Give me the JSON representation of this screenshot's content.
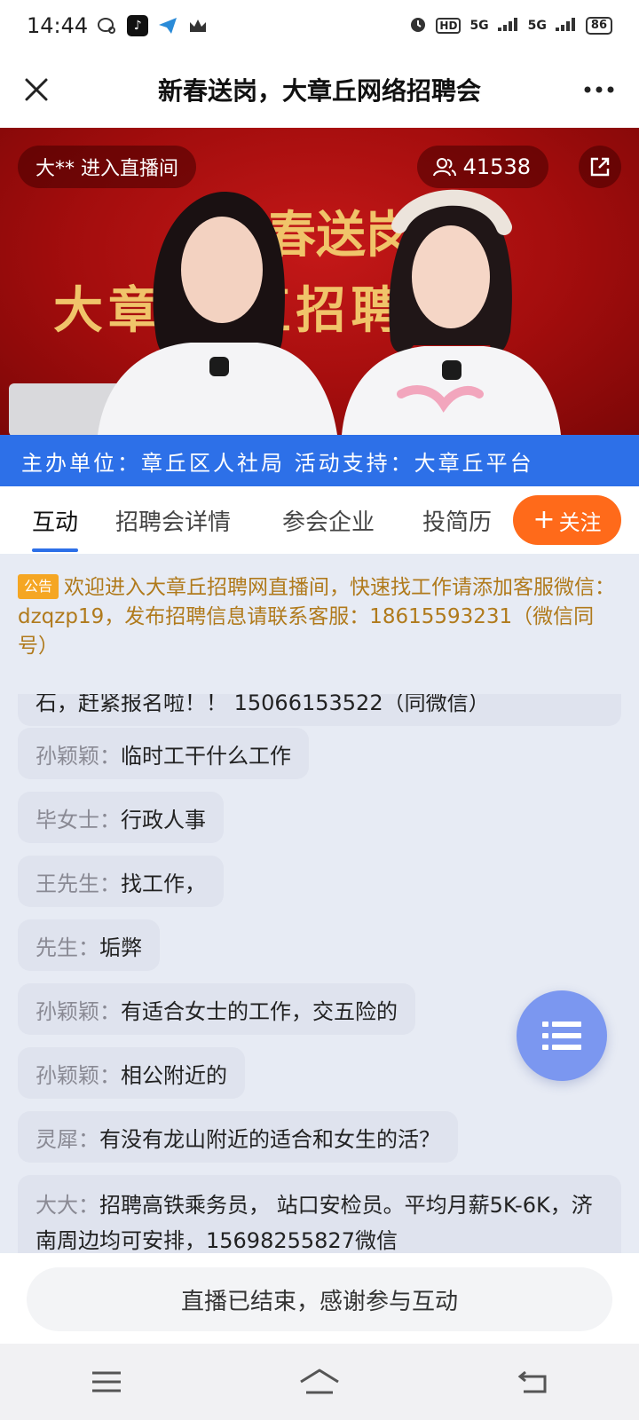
{
  "status_bar": {
    "time": "14:44",
    "network_1": "5G",
    "network_2": "5G",
    "hd_label": "HD",
    "battery": "86"
  },
  "header": {
    "title": "新春送岗，大章丘网络招聘会",
    "close_icon": "close-icon",
    "more_icon": "more-icon"
  },
  "live": {
    "join_notice": "大** 进入直播间",
    "viewer_count": "41538",
    "banner_line1": "春送岗",
    "banner_line2": "大章 络直招聘会",
    "organizer": "主办单位：章丘区人社局 活动支持：大章丘平台"
  },
  "tabs": [
    {
      "label": "互动"
    },
    {
      "label": "招聘会详情"
    },
    {
      "label": "参会企业"
    },
    {
      "label": "投简历"
    }
  ],
  "follow_button": {
    "plus": "+",
    "label": "关注"
  },
  "notice": {
    "badge": "公告",
    "text": "欢迎进入大章丘招聘网直播间，快速找工作请添加客服微信：dzqzp19，发布招聘信息请联系客服：18615593231（微信同号）"
  },
  "messages": [
    {
      "name": "",
      "text": "石，赶紧报名啦！！ 15066153522（同微信）"
    },
    {
      "name": "孙颖颖：",
      "text": "临时工干什么工作"
    },
    {
      "name": "毕女士：",
      "text": "行政人事"
    },
    {
      "name": "王先生：",
      "text": "找工作，"
    },
    {
      "name": "先生：",
      "text": "垢弊"
    },
    {
      "name": "孙颖颖：",
      "text": "有适合女士的工作，交五险的"
    },
    {
      "name": "孙颖颖：",
      "text": "相公附近的"
    },
    {
      "name": "灵犀：",
      "text": "有没有龙山附近的适合和女生的活？"
    },
    {
      "name": "大大：",
      "text": "招聘高铁乘务员， 站口安检员。平均月薪5K-6K，济南周边均可安排，15698255827微信"
    }
  ],
  "footer": {
    "ended_text": "直播已结束，感谢参与互动"
  },
  "colors": {
    "brand_blue": "#2d70e8",
    "follow_orange": "#ff6a1a",
    "notice_gold": "#b07a1c",
    "video_red": "#a30d0d",
    "fab_blue": "#7b97f0"
  }
}
